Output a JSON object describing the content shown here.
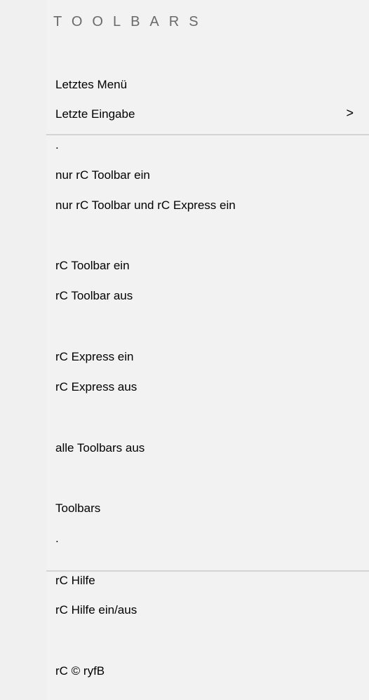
{
  "menu": {
    "title": "TOOLBARS",
    "items": [
      {
        "label": "Letztes Menü"
      },
      {
        "label": "Letzte Eingabe",
        "submenu_indicator": ">"
      },
      {
        "label": "."
      },
      {
        "label": "nur rC Toolbar ein"
      },
      {
        "label": "nur rC Toolbar und rC Express ein"
      },
      {
        "label": "rC Toolbar ein"
      },
      {
        "label": "rC Toolbar aus"
      },
      {
        "label": "rC Express ein"
      },
      {
        "label": "rC Express aus"
      },
      {
        "label": "alle Toolbars aus"
      },
      {
        "label": "Toolbars"
      },
      {
        "label": "."
      },
      {
        "label": "rC Hilfe"
      },
      {
        "label": "rC Hilfe ein/aus"
      },
      {
        "label": "rC © ryfB"
      }
    ]
  }
}
